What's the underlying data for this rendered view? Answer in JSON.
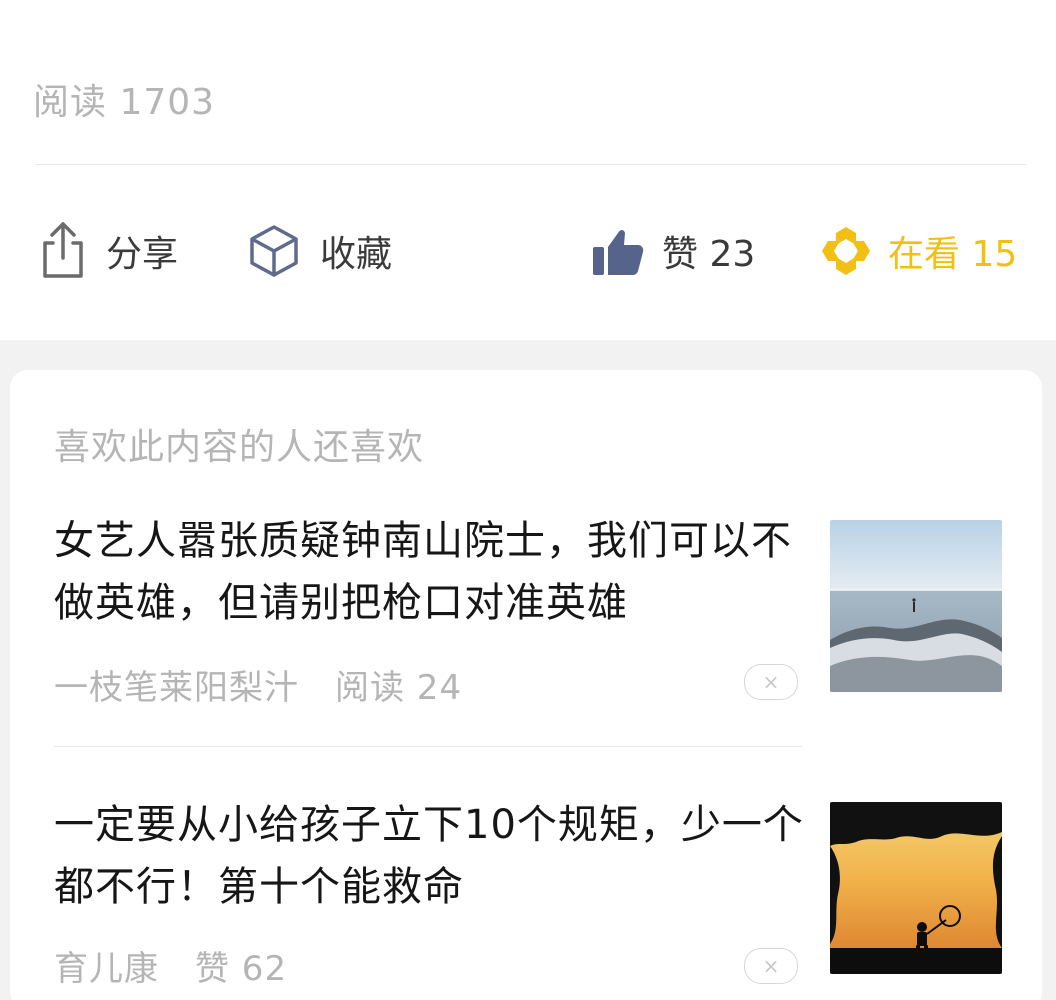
{
  "article": {
    "read_label": "阅读",
    "read_value": "1703"
  },
  "actions": {
    "share": {
      "label": "分享",
      "icon": "share-icon"
    },
    "collect": {
      "label": "收藏",
      "icon": "box-icon"
    },
    "like": {
      "label": "赞 23",
      "icon": "thumbs-up-icon"
    },
    "watching": {
      "label": "在看 15",
      "icon": "watching-icon"
    }
  },
  "recommendations": {
    "title": "喜欢此内容的人还喜欢",
    "items": [
      {
        "title": "女艺人嚣张质疑钟南山院士，我们可以不做英雄，但请别把枪口对准英雄",
        "meta_author": "一枝笔莱阳梨汁",
        "meta_stat": "阅读 24",
        "close_label": "×",
        "thumb_icon": "sea-rock-photo"
      },
      {
        "title": "一定要从小给孩子立下10个规矩，少一个都不行！第十个能救命",
        "meta_author": "育儿康",
        "meta_stat": "赞 62",
        "close_label": "×",
        "thumb_icon": "sunset-child-photo"
      }
    ]
  },
  "colors": {
    "gold": "#f2bf14",
    "like_blue": "#56648c",
    "muted": "#b5b5b5",
    "gray_bg": "#f2f2f2"
  }
}
